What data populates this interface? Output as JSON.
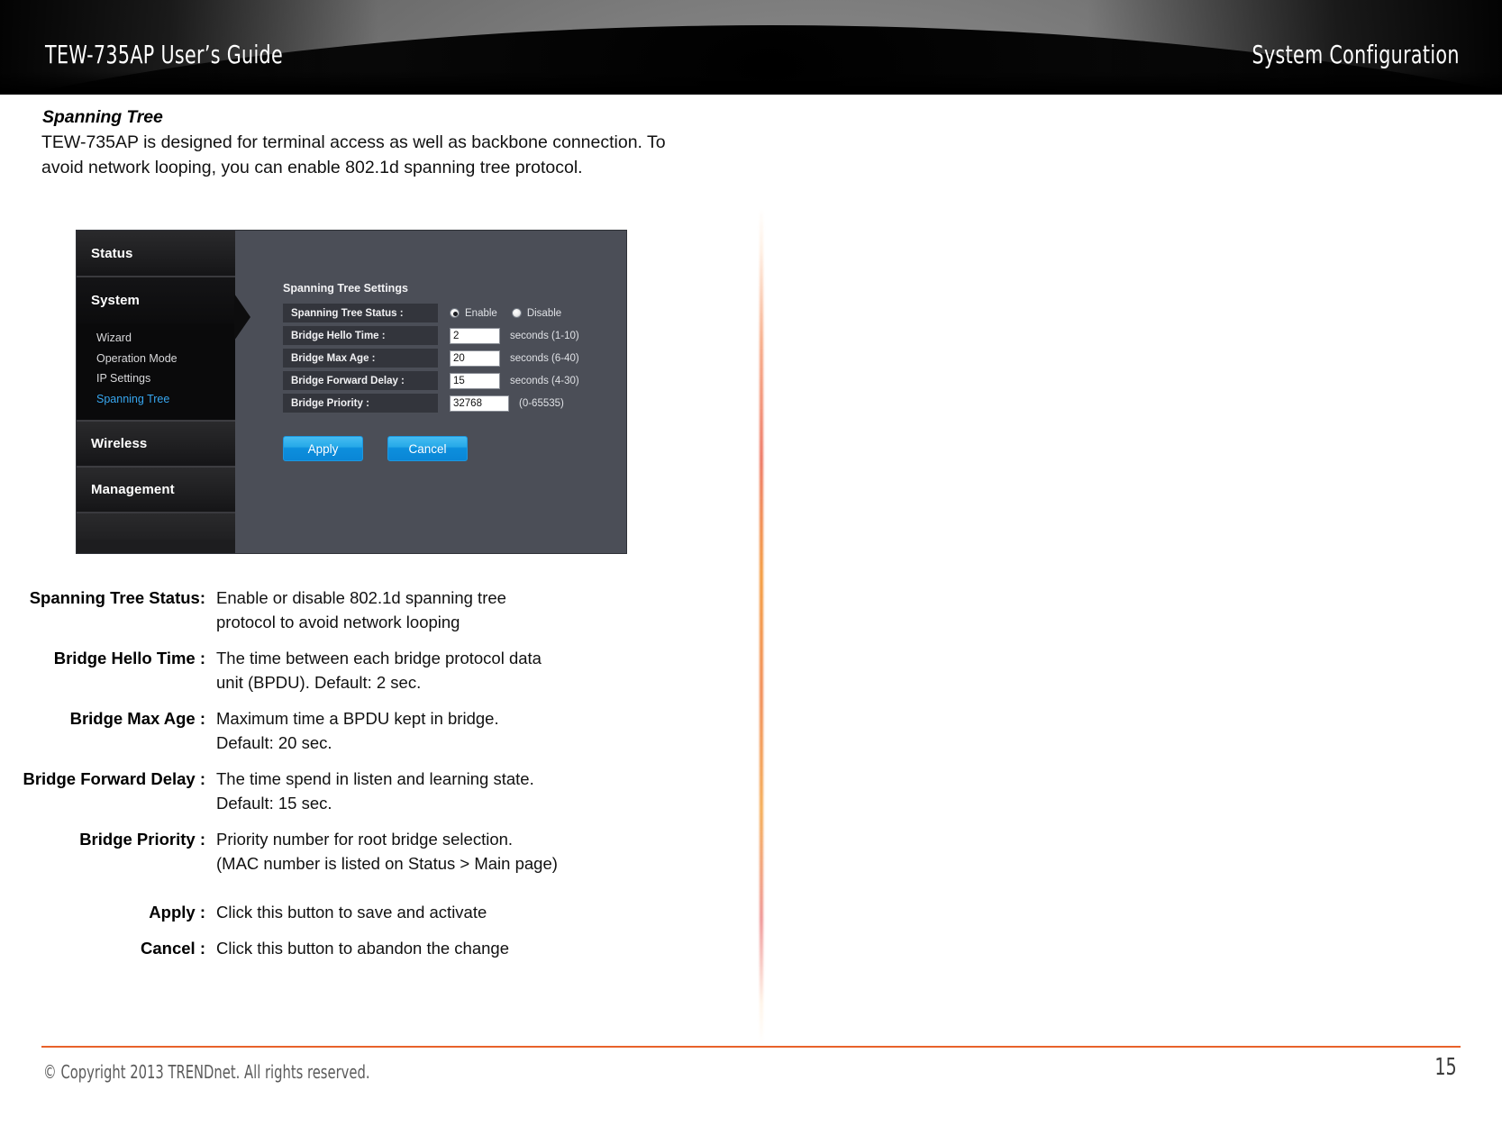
{
  "header": {
    "doc_title": "TEW-735AP User’s Guide",
    "section_title": "System Configuration"
  },
  "body": {
    "section_heading": "Spanning Tree",
    "intro_paragraph": "TEW-735AP is designed for terminal access as well as backbone connection. To avoid network looping, you can enable 802.1d spanning tree protocol."
  },
  "ui_screenshot": {
    "nav": {
      "status_label": "Status",
      "system_label": "System",
      "system_children": [
        {
          "label": "Wizard",
          "active": false
        },
        {
          "label": "Operation Mode",
          "active": false
        },
        {
          "label": "IP Settings",
          "active": false
        },
        {
          "label": "Spanning Tree",
          "active": true
        }
      ],
      "wireless_label": "Wireless",
      "management_label": "Management"
    },
    "panel": {
      "title": "Spanning Tree Settings",
      "rows": [
        {
          "label": "Spanning Tree Status :",
          "type": "radio",
          "options": [
            "Enable",
            "Disable"
          ],
          "selected": "Enable"
        },
        {
          "label": "Bridge Hello Time :",
          "type": "text",
          "value": "2",
          "hint": "seconds (1-10)"
        },
        {
          "label": "Bridge Max Age :",
          "type": "text",
          "value": "20",
          "hint": "seconds (6-40)"
        },
        {
          "label": "Bridge Forward Delay :",
          "type": "text",
          "value": "15",
          "hint": "seconds (4-30)"
        },
        {
          "label": "Bridge Priority :",
          "type": "text",
          "value": "32768",
          "hint": "(0-65535)"
        }
      ],
      "apply_label": "Apply",
      "cancel_label": "Cancel"
    },
    "colors": {
      "panel_bg": "#4b4e57",
      "nav_bg": "#1d1d1f",
      "active_link": "#37a7f0",
      "button_blue": "#27a9e8"
    }
  },
  "definitions": [
    {
      "term": "Spanning Tree Status:",
      "desc": "Enable or disable 802.1d spanning tree protocol to avoid network looping"
    },
    {
      "term": "Bridge Hello Time :",
      "desc": "The time between each bridge protocol data unit (BPDU). Default: 2 sec."
    },
    {
      "term": "Bridge Max Age :",
      "desc": "Maximum time a BPDU kept in bridge. Default: 20 sec."
    },
    {
      "term": "Bridge Forward Delay :",
      "desc": "The time spend in listen and learning state. Default: 15 sec."
    },
    {
      "term": "Bridge Priority :",
      "desc": "Priority number for root bridge selection. (MAC number is listed on Status > Main page)"
    },
    {
      "term": "Apply :",
      "desc": "Click this button to save and activate"
    },
    {
      "term": "Cancel :",
      "desc": "Click this button to abandon the change"
    }
  ],
  "footer": {
    "copyright": "© Copyright 2013 TRENDnet. All rights reserved.",
    "page_number": "15",
    "rule_color": "#e8622a"
  }
}
